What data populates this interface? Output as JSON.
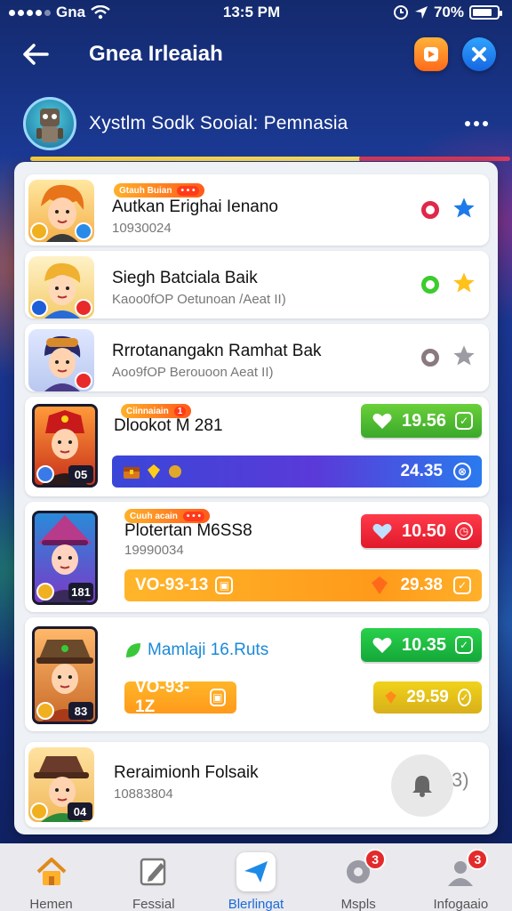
{
  "status_bar": {
    "carrier": "Gna",
    "time": "13:5 PM",
    "battery": "70%"
  },
  "header": {
    "title": "Gnea Irleaiah"
  },
  "group": {
    "title": "Xystlm Sodk Sooial: Pemnasia"
  },
  "members": [
    {
      "tag_a": "Gtauh Buian",
      "tag_b": "• • •",
      "name": "Autkan Erighai Ienano",
      "sub": "10930024",
      "ring_color": "#e0284a",
      "star_color": "#1e7ae8"
    },
    {
      "name": "Siegh Batciala Baik",
      "sub": "Kaoo0fOP Oetunoan /Aeat II)",
      "ring_color": "#3ccc2e",
      "star_color": "#ffc21a"
    },
    {
      "name": "Rrrotanangakn Ramhat Bak",
      "sub": "Aoo9fOP Berouoon Aeat II)",
      "ring_color": "#8a7a80",
      "star_color": "#9c9ca4"
    }
  ],
  "players": [
    {
      "tag_a": "Ciinnaiain",
      "tag_b": "1",
      "name": "Dlookot M 281",
      "level": "05",
      "stat": "19.56",
      "bar_value": "24.35"
    },
    {
      "tag_a": "Cuuh acain",
      "tag_b": "• • •",
      "name": "Plotertan M6SS8",
      "sub": "19990034",
      "level": "181",
      "stat": "10.50",
      "bar_left": "VO-93-13",
      "bar_value": "29.38"
    },
    {
      "name": "Mamlaji 16.Ruts",
      "level": "83",
      "stat": "10.35",
      "bar_left": "VO-93-1Z",
      "bar_value": "29.59"
    }
  ],
  "last": {
    "name": "Reraimionh Folsaik",
    "sub": "10883804",
    "level": "04",
    "extra": "3)"
  },
  "nav": [
    {
      "label": "Hemen"
    },
    {
      "label": "Fessial"
    },
    {
      "label": "Blerlingat"
    },
    {
      "label": "Mspls",
      "badge": "3"
    },
    {
      "label": "Infogaaio",
      "badge": "3"
    }
  ],
  "colors": {
    "green": "#38b82a",
    "red": "#e8283a",
    "orange": "#ff9d1a",
    "blue_bar": "#3a3acc",
    "yellow": "#e8c11a"
  }
}
